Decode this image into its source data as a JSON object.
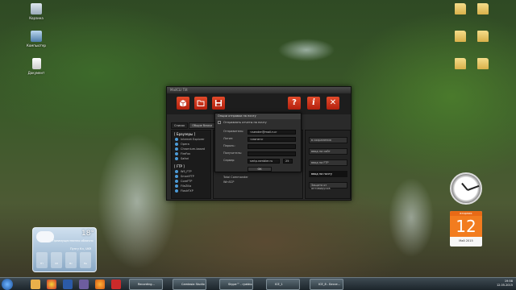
{
  "desktop": {
    "icons_left": [
      {
        "label": "Корзина"
      },
      {
        "label": "Компьютер"
      },
      {
        "label": "Документ"
      }
    ],
    "icons_right": [
      {
        "label": ""
      },
      {
        "label": ""
      },
      {
        "label": ""
      },
      {
        "label": ""
      },
      {
        "label": ""
      },
      {
        "label": ""
      }
    ]
  },
  "weather": {
    "temperature": "18°",
    "condition": "Преимущественно облачно",
    "location": "Пунгу Кл, UKR",
    "days": [
      "Пт",
      "Сб",
      "Вс",
      "Пн"
    ]
  },
  "calendar": {
    "weekday": "вторник",
    "day": "12",
    "month_year": "Май 2015"
  },
  "app": {
    "title": "MailCLI Tilt",
    "toolbar": {
      "open": "",
      "folder": "",
      "save": "",
      "help": "?",
      "info": "i",
      "close": "✕"
    },
    "tabs": [
      "Список",
      "Общие блоки",
      "Паро"
    ],
    "groups": [
      {
        "title": "[ Браузеры ]",
        "items": [
          "Internet Explorer",
          "Opera",
          "Chromium-based",
          "FireFox",
          "Safari"
        ]
      },
      {
        "title": "[ FTP ]",
        "items": [
          "WS_FTP",
          "SmartFTP",
          "CoreFTP",
          "FileZilla",
          "FlashFXP"
        ]
      }
    ],
    "mid_items": [
      "Total Commander",
      "WinSCP"
    ],
    "right_buttons": [
      "в сохранения",
      "ввод на сайт",
      "ввод на FTP",
      "ввод на почту",
      "Защита от антивирусов"
    ],
    "right_highlight": "ввод на почту"
  },
  "dialog": {
    "title": "Опции отправки на почту",
    "checkbox": "Отправлять отчеты на почту",
    "fields": [
      {
        "label": "Отправитель:",
        "value": "<sender@mail.ru>"
      },
      {
        "label": "Логин:",
        "value": "<логин>"
      },
      {
        "label": "Пароль:",
        "value": ""
      },
      {
        "label": "Получатель:",
        "value": ""
      },
      {
        "label": "Сервер:",
        "value": "smtp.rambler.ru"
      }
    ],
    "port": "25",
    "ok": "OK"
  },
  "taskbar": {
    "tasks": [
      "Recording...",
      "Camtasia Studio",
      "Skype™ - ryabko...",
      "ICE_1",
      "ICE_8 - Бессе..."
    ],
    "time": "19:58",
    "date": "12.05.2015"
  },
  "colors": {
    "accent_red": "#c82a12",
    "window_bg": "#2a2a2a",
    "calendar_orange": "#f27c1f"
  }
}
